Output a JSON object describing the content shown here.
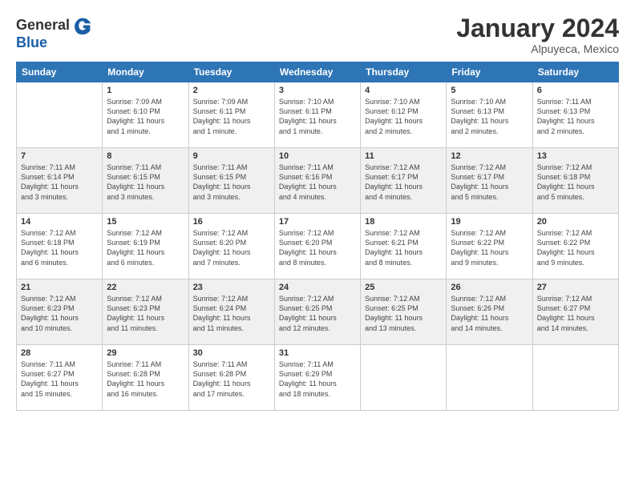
{
  "header": {
    "logo_general": "General",
    "logo_blue": "Blue",
    "month_title": "January 2024",
    "location": "Alpuyeca, Mexico"
  },
  "days_of_week": [
    "Sunday",
    "Monday",
    "Tuesday",
    "Wednesday",
    "Thursday",
    "Friday",
    "Saturday"
  ],
  "weeks": [
    {
      "row_class": "row-white",
      "days": [
        {
          "num": "",
          "info": ""
        },
        {
          "num": "1",
          "info": "Sunrise: 7:09 AM\nSunset: 6:10 PM\nDaylight: 11 hours\nand 1 minute."
        },
        {
          "num": "2",
          "info": "Sunrise: 7:09 AM\nSunset: 6:11 PM\nDaylight: 11 hours\nand 1 minute."
        },
        {
          "num": "3",
          "info": "Sunrise: 7:10 AM\nSunset: 6:11 PM\nDaylight: 11 hours\nand 1 minute."
        },
        {
          "num": "4",
          "info": "Sunrise: 7:10 AM\nSunset: 6:12 PM\nDaylight: 11 hours\nand 2 minutes."
        },
        {
          "num": "5",
          "info": "Sunrise: 7:10 AM\nSunset: 6:13 PM\nDaylight: 11 hours\nand 2 minutes."
        },
        {
          "num": "6",
          "info": "Sunrise: 7:11 AM\nSunset: 6:13 PM\nDaylight: 11 hours\nand 2 minutes."
        }
      ]
    },
    {
      "row_class": "row-alt",
      "days": [
        {
          "num": "7",
          "info": "Sunrise: 7:11 AM\nSunset: 6:14 PM\nDaylight: 11 hours\nand 3 minutes."
        },
        {
          "num": "8",
          "info": "Sunrise: 7:11 AM\nSunset: 6:15 PM\nDaylight: 11 hours\nand 3 minutes."
        },
        {
          "num": "9",
          "info": "Sunrise: 7:11 AM\nSunset: 6:15 PM\nDaylight: 11 hours\nand 3 minutes."
        },
        {
          "num": "10",
          "info": "Sunrise: 7:11 AM\nSunset: 6:16 PM\nDaylight: 11 hours\nand 4 minutes."
        },
        {
          "num": "11",
          "info": "Sunrise: 7:12 AM\nSunset: 6:17 PM\nDaylight: 11 hours\nand 4 minutes."
        },
        {
          "num": "12",
          "info": "Sunrise: 7:12 AM\nSunset: 6:17 PM\nDaylight: 11 hours\nand 5 minutes."
        },
        {
          "num": "13",
          "info": "Sunrise: 7:12 AM\nSunset: 6:18 PM\nDaylight: 11 hours\nand 5 minutes."
        }
      ]
    },
    {
      "row_class": "row-white",
      "days": [
        {
          "num": "14",
          "info": "Sunrise: 7:12 AM\nSunset: 6:18 PM\nDaylight: 11 hours\nand 6 minutes."
        },
        {
          "num": "15",
          "info": "Sunrise: 7:12 AM\nSunset: 6:19 PM\nDaylight: 11 hours\nand 6 minutes."
        },
        {
          "num": "16",
          "info": "Sunrise: 7:12 AM\nSunset: 6:20 PM\nDaylight: 11 hours\nand 7 minutes."
        },
        {
          "num": "17",
          "info": "Sunrise: 7:12 AM\nSunset: 6:20 PM\nDaylight: 11 hours\nand 8 minutes."
        },
        {
          "num": "18",
          "info": "Sunrise: 7:12 AM\nSunset: 6:21 PM\nDaylight: 11 hours\nand 8 minutes."
        },
        {
          "num": "19",
          "info": "Sunrise: 7:12 AM\nSunset: 6:22 PM\nDaylight: 11 hours\nand 9 minutes."
        },
        {
          "num": "20",
          "info": "Sunrise: 7:12 AM\nSunset: 6:22 PM\nDaylight: 11 hours\nand 9 minutes."
        }
      ]
    },
    {
      "row_class": "row-alt",
      "days": [
        {
          "num": "21",
          "info": "Sunrise: 7:12 AM\nSunset: 6:23 PM\nDaylight: 11 hours\nand 10 minutes."
        },
        {
          "num": "22",
          "info": "Sunrise: 7:12 AM\nSunset: 6:23 PM\nDaylight: 11 hours\nand 11 minutes."
        },
        {
          "num": "23",
          "info": "Sunrise: 7:12 AM\nSunset: 6:24 PM\nDaylight: 11 hours\nand 11 minutes."
        },
        {
          "num": "24",
          "info": "Sunrise: 7:12 AM\nSunset: 6:25 PM\nDaylight: 11 hours\nand 12 minutes."
        },
        {
          "num": "25",
          "info": "Sunrise: 7:12 AM\nSunset: 6:25 PM\nDaylight: 11 hours\nand 13 minutes."
        },
        {
          "num": "26",
          "info": "Sunrise: 7:12 AM\nSunset: 6:26 PM\nDaylight: 11 hours\nand 14 minutes."
        },
        {
          "num": "27",
          "info": "Sunrise: 7:12 AM\nSunset: 6:27 PM\nDaylight: 11 hours\nand 14 minutes."
        }
      ]
    },
    {
      "row_class": "row-white",
      "days": [
        {
          "num": "28",
          "info": "Sunrise: 7:11 AM\nSunset: 6:27 PM\nDaylight: 11 hours\nand 15 minutes."
        },
        {
          "num": "29",
          "info": "Sunrise: 7:11 AM\nSunset: 6:28 PM\nDaylight: 11 hours\nand 16 minutes."
        },
        {
          "num": "30",
          "info": "Sunrise: 7:11 AM\nSunset: 6:28 PM\nDaylight: 11 hours\nand 17 minutes."
        },
        {
          "num": "31",
          "info": "Sunrise: 7:11 AM\nSunset: 6:29 PM\nDaylight: 11 hours\nand 18 minutes."
        },
        {
          "num": "",
          "info": ""
        },
        {
          "num": "",
          "info": ""
        },
        {
          "num": "",
          "info": ""
        }
      ]
    }
  ]
}
